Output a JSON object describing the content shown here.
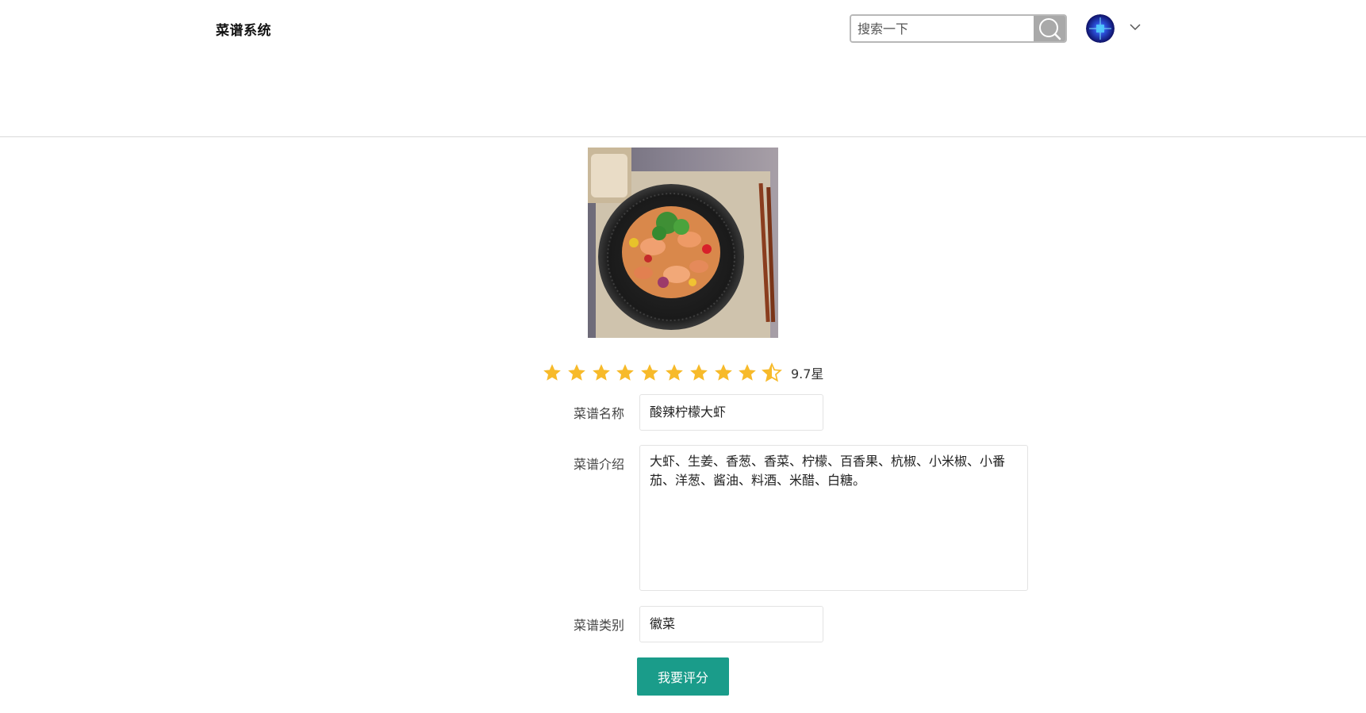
{
  "app": {
    "title": "菜谱系统"
  },
  "header": {
    "search_placeholder": "搜索一下",
    "search_icon": "search-icon",
    "avatar_icon": "avatar",
    "menu_icon": "chevron-down-icon"
  },
  "recipe": {
    "rating_value": 9.7,
    "rating_stars": 4.85,
    "rating_text": "9.7星",
    "name_label": "菜谱名称",
    "name_value": "酸辣柠檬大虾",
    "intro_label": "菜谱介绍",
    "intro_value": "大虾、生姜、香葱、香菜、柠檬、百香果、杭椒、小米椒、小番茄、洋葱、酱油、料酒、米醋、白糖。",
    "category_label": "菜谱类别",
    "category_value": "徽菜"
  },
  "actions": {
    "rate_label": "我要评分"
  },
  "colors": {
    "accent": "#1a9c8a",
    "star": "#f7ba2a",
    "divider": "#d9d9d9"
  }
}
